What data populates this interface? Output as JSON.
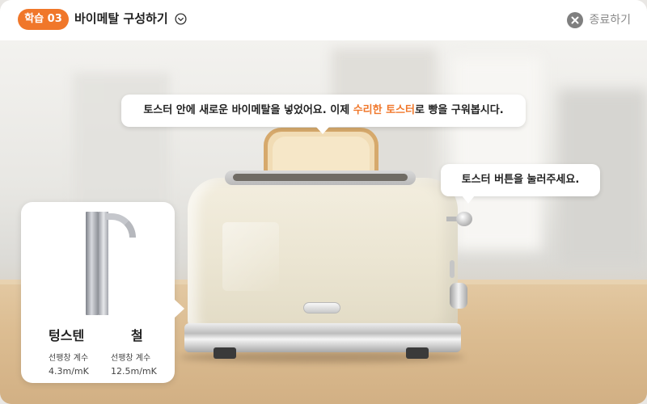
{
  "header": {
    "lesson_badge": "학습 03",
    "lesson_title": "바이메탈 구성하기",
    "close_label": "종료하기"
  },
  "bubbles": {
    "intro_before": "토스터 안에 새로운 바이메탈을 넣었어요. 이제 ",
    "intro_highlight": "수리한 토스터",
    "intro_after": "로 빵을 구워봅시다.",
    "button_hint": "토스터 버튼을 눌러주세요."
  },
  "metal_card": {
    "metals": [
      {
        "name": "텅스텐",
        "label": "선팽창 계수",
        "value": "4.3m/mK"
      },
      {
        "name": "철",
        "label": "선팽창 계수",
        "value": "12.5m/mK"
      }
    ]
  },
  "colors": {
    "accent": "#f0772a",
    "close_gray": "#8a8a8a"
  },
  "icons": {
    "title": "check-circle-icon",
    "close": "close-circle-icon"
  }
}
